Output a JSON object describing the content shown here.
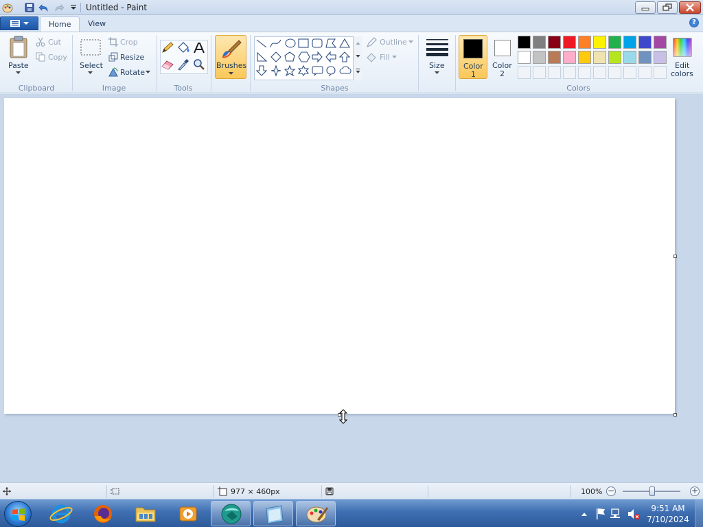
{
  "window": {
    "title": "Untitled - Paint"
  },
  "tabs": {
    "home": "Home",
    "view": "View"
  },
  "clipboard": {
    "paste": "Paste",
    "cut": "Cut",
    "copy": "Copy",
    "group": "Clipboard"
  },
  "image": {
    "select": "Select",
    "crop": "Crop",
    "resize": "Resize",
    "rotate": "Rotate",
    "group": "Image"
  },
  "tools": {
    "group": "Tools"
  },
  "brushes": {
    "label": "Brushes"
  },
  "shapes": {
    "outline": "Outline",
    "fill": "Fill",
    "group": "Shapes"
  },
  "size": {
    "label": "Size"
  },
  "colors": {
    "color1_line1": "Color",
    "color1_line2": "1",
    "color2_line1": "Color",
    "color2_line2": "2",
    "edit_line1": "Edit",
    "edit_line2": "colors",
    "group": "Colors",
    "color1_value": "#000000",
    "color2_value": "#ffffff",
    "palette_row1": [
      "#000000",
      "#7f7f7f",
      "#880015",
      "#ed1c24",
      "#ff7f27",
      "#fff200",
      "#22b14c",
      "#00a2e8",
      "#3f48cc",
      "#a349a4"
    ],
    "palette_row2": [
      "#ffffff",
      "#c3c3c3",
      "#b97a57",
      "#ffaec9",
      "#ffc90e",
      "#efe4b0",
      "#b5e61d",
      "#99d9ea",
      "#7092be",
      "#c8bfe7"
    ]
  },
  "status": {
    "canvas_size": "977 × 460px",
    "zoom": "100%"
  },
  "clock": {
    "time": "9:51 AM",
    "date": "7/10/2024"
  }
}
